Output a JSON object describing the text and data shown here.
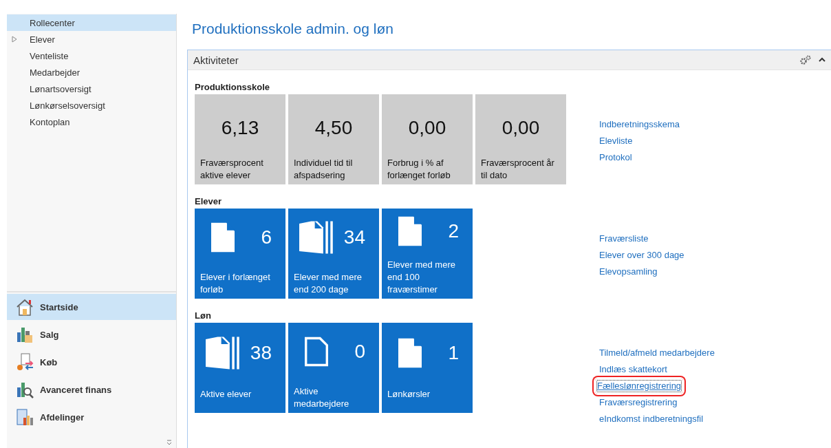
{
  "navigation": {
    "items": [
      {
        "label": "Rollecenter",
        "selected": true,
        "expandable": false
      },
      {
        "label": "Elever",
        "selected": false,
        "expandable": true
      },
      {
        "label": "Venteliste",
        "selected": false,
        "expandable": false
      },
      {
        "label": "Medarbejder",
        "selected": false,
        "expandable": false
      },
      {
        "label": "Lønartsoversigt",
        "selected": false,
        "expandable": false
      },
      {
        "label": "Lønkørselsoversigt",
        "selected": false,
        "expandable": false
      },
      {
        "label": "Kontoplan",
        "selected": false,
        "expandable": false
      }
    ],
    "departments": [
      {
        "label": "Startside",
        "selected": true
      },
      {
        "label": "Salg",
        "selected": false
      },
      {
        "label": "Køb",
        "selected": false
      },
      {
        "label": "Avanceret finans",
        "selected": false
      },
      {
        "label": "Afdelinger",
        "selected": false
      }
    ]
  },
  "page_title": "Produktionsskole admin. og løn",
  "activities": {
    "title": "Aktiviteter",
    "sections": [
      {
        "heading": "Produktionsskole",
        "tiles": [
          {
            "kind": "metric",
            "value": "6,13",
            "label": "Fraværsprocent aktive elever"
          },
          {
            "kind": "metric",
            "value": "4,50",
            "label": "Individuel tid til afspadsering"
          },
          {
            "kind": "metric",
            "value": "0,00",
            "label": "Forbrug i % af forlænget forløb"
          },
          {
            "kind": "metric",
            "value": "0,00",
            "label": "Fraværsprocent år til dato"
          }
        ],
        "links": [
          {
            "label": "Indberetningsskema",
            "focused": false
          },
          {
            "label": "Elevliste",
            "focused": false
          },
          {
            "label": "Protokol",
            "focused": false
          }
        ]
      },
      {
        "heading": "Elever",
        "tiles": [
          {
            "kind": "single",
            "value": "6",
            "label": "Elever i forlænget forløb"
          },
          {
            "kind": "stack",
            "value": "34",
            "label": "Elever med mere end 200 dage"
          },
          {
            "kind": "single",
            "value": "2",
            "label": "Elever med mere end 100 fraværstimer"
          }
        ],
        "links": [
          {
            "label": "Fraværsliste",
            "focused": false
          },
          {
            "label": "Elever over 300 dage",
            "focused": false
          },
          {
            "label": "Elevopsamling",
            "focused": false
          }
        ]
      },
      {
        "heading": "Løn",
        "tiles": [
          {
            "kind": "stack",
            "value": "38",
            "label": "Aktive elever"
          },
          {
            "kind": "outline",
            "value": "0",
            "label": "Aktive medarbejdere"
          },
          {
            "kind": "single",
            "value": "1",
            "label": "Lønkørsler"
          }
        ],
        "links": [
          {
            "label": "Tilmeld/afmeld medarbejdere",
            "focused": false
          },
          {
            "label": "Indlæs skattekort",
            "focused": false
          },
          {
            "label": "Fælleslønregistrering",
            "focused": true
          },
          {
            "label": "Fraværsregistrering",
            "focused": false
          },
          {
            "label": "eIndkomst indberetningsfil",
            "focused": false
          }
        ]
      }
    ]
  }
}
